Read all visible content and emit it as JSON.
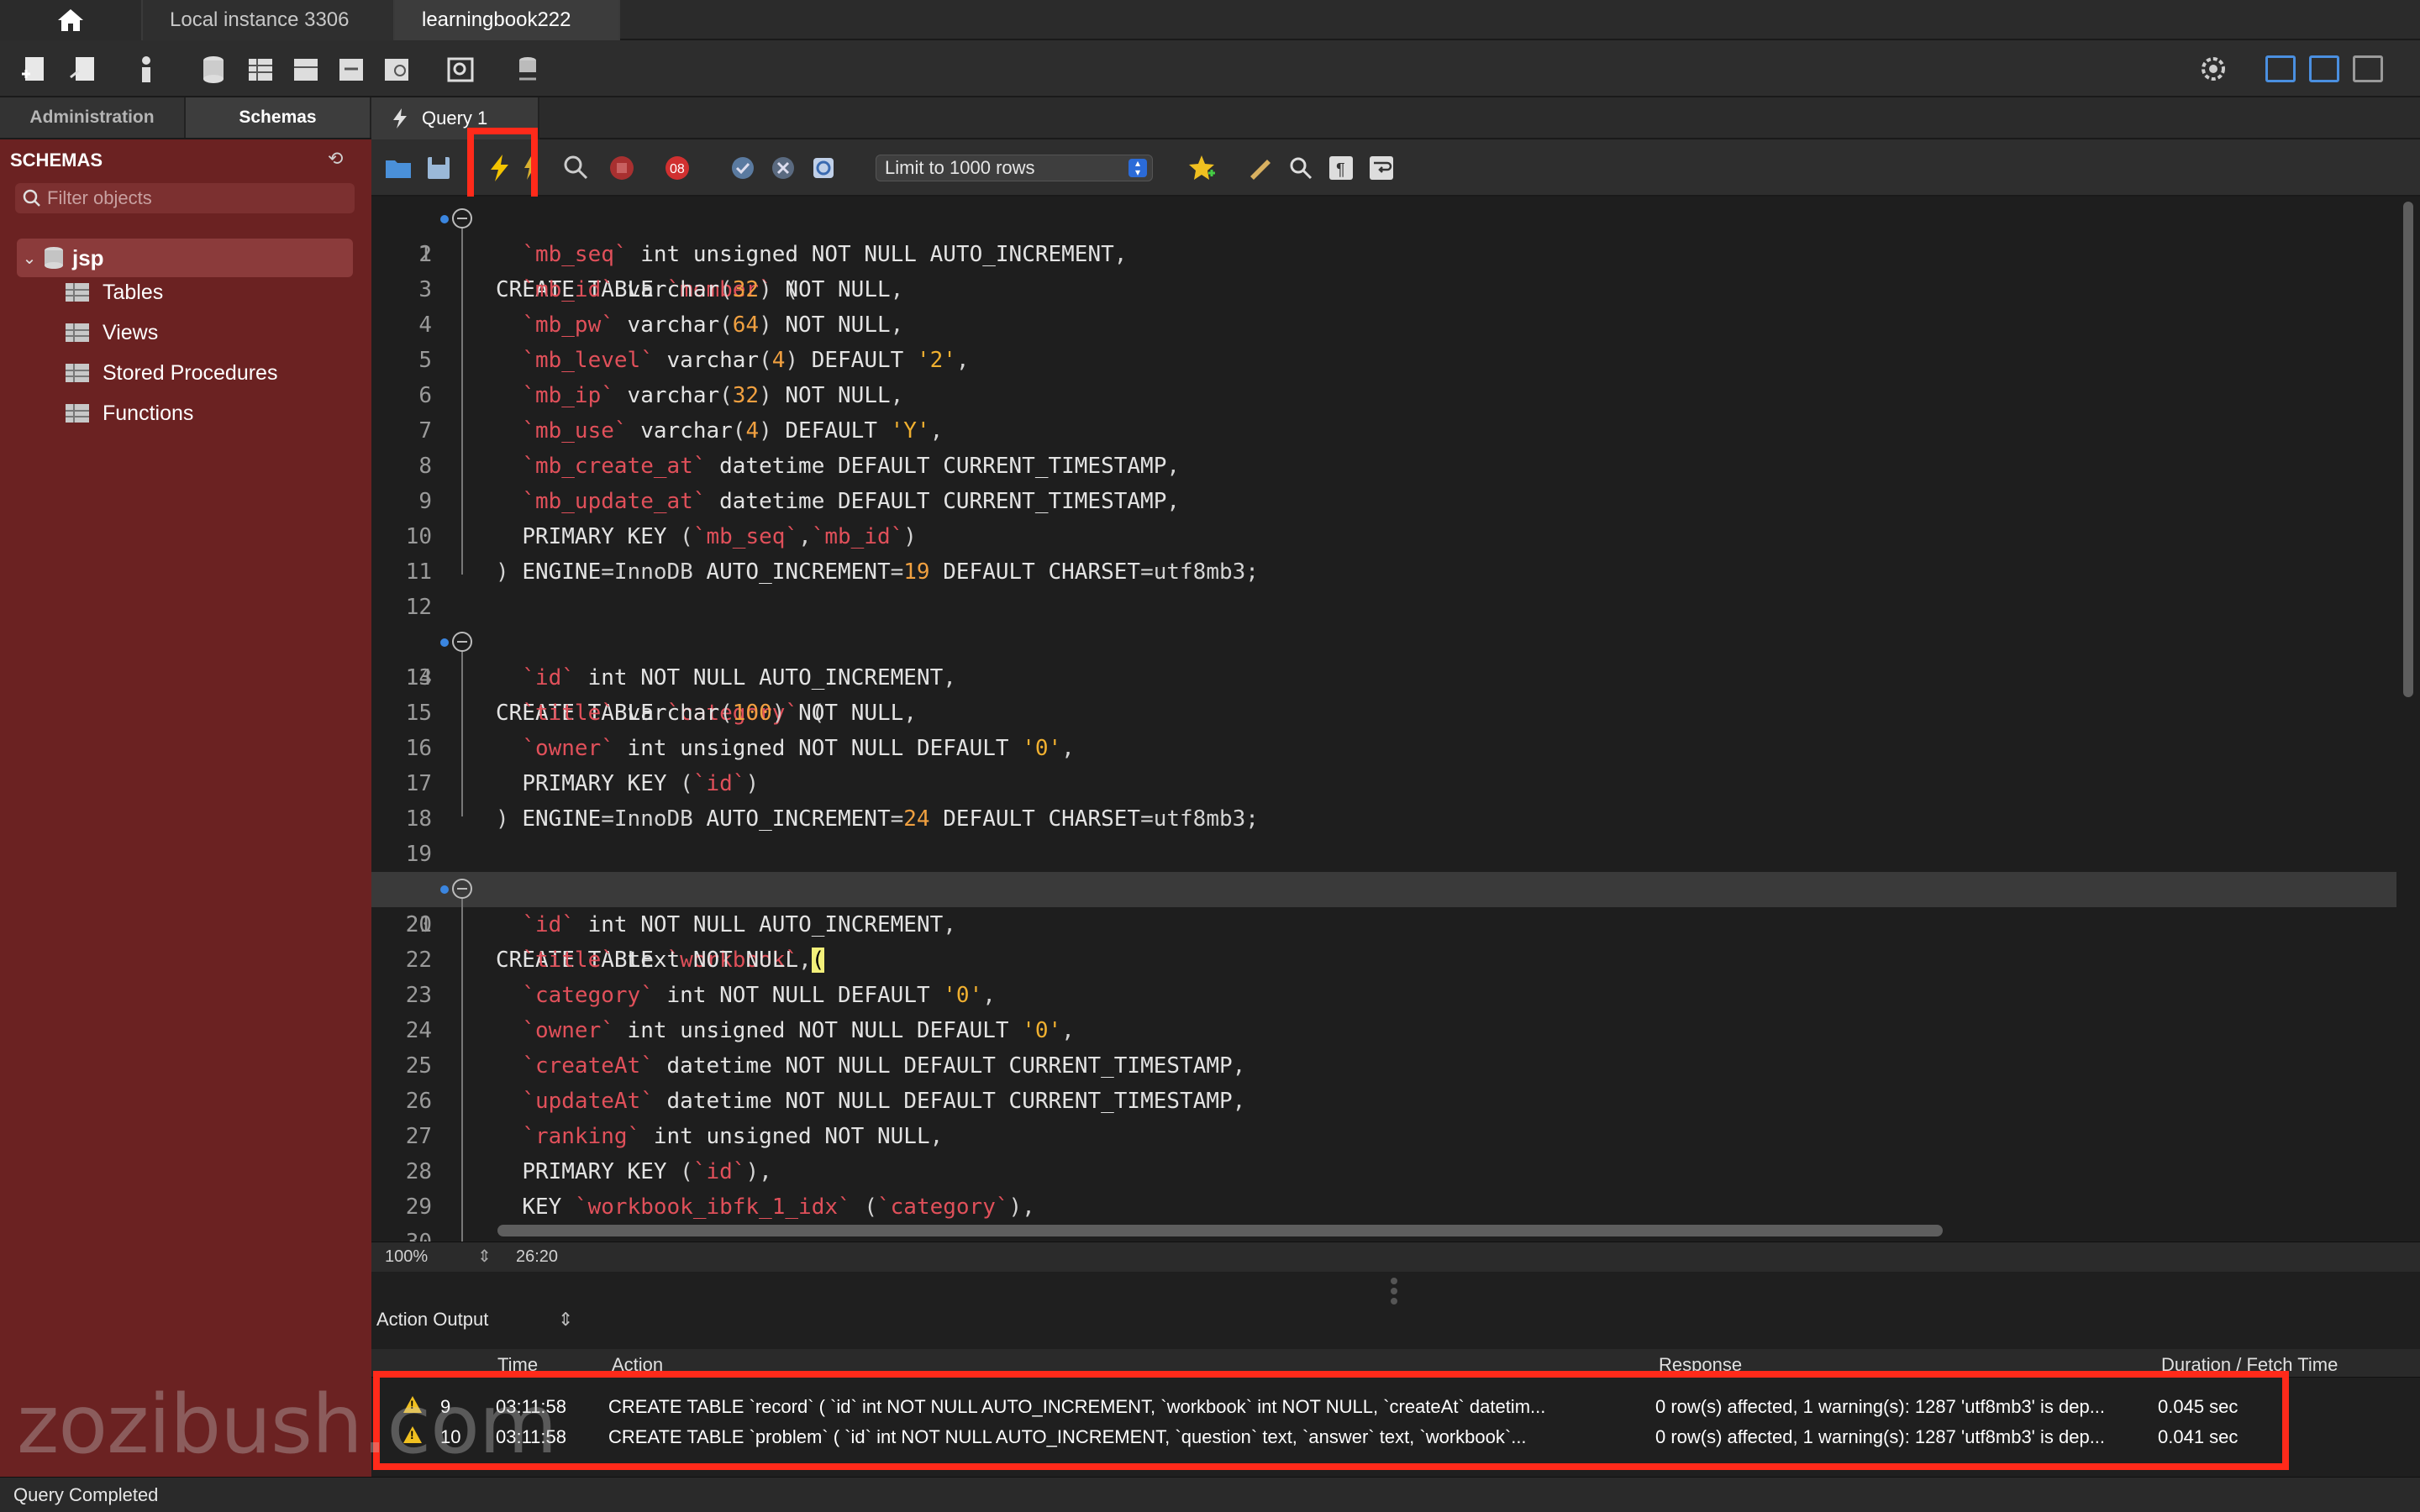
{
  "tabs": {
    "home": "home",
    "connections": [
      {
        "label": "Local instance 3306",
        "active": false
      },
      {
        "label": "learningbook222",
        "active": true
      }
    ]
  },
  "sidebar": {
    "tabs": [
      {
        "label": "Administration",
        "active": false
      },
      {
        "label": "Schemas",
        "active": true
      }
    ],
    "heading": "SCHEMAS",
    "filter_placeholder": "Filter objects",
    "schema": "jsp",
    "items": [
      "Tables",
      "Views",
      "Stored Procedures",
      "Functions"
    ]
  },
  "query_tab": {
    "label": "Query 1"
  },
  "sql_toolbar": {
    "limit_select": "Limit to 1000 rows"
  },
  "editor": {
    "lines": [
      "CREATE TABLE `member` (",
      "  `mb_seq` int unsigned NOT NULL AUTO_INCREMENT,",
      "  `mb_id` varchar(32) NOT NULL,",
      "  `mb_pw` varchar(64) NOT NULL,",
      "  `mb_level` varchar(4) DEFAULT '2',",
      "  `mb_ip` varchar(32) NOT NULL,",
      "  `mb_use` varchar(4) DEFAULT 'Y',",
      "  `mb_create_at` datetime DEFAULT CURRENT_TIMESTAMP,",
      "  `mb_update_at` datetime DEFAULT CURRENT_TIMESTAMP,",
      "  PRIMARY KEY (`mb_seq`,`mb_id`)",
      ") ENGINE=InnoDB AUTO_INCREMENT=19 DEFAULT CHARSET=utf8mb3;",
      "",
      "CREATE TABLE `category` (",
      "  `id` int NOT NULL AUTO_INCREMENT,",
      "  `title` varchar(100) NOT NULL,",
      "  `owner` int unsigned NOT NULL DEFAULT '0',",
      "  PRIMARY KEY (`id`)",
      ") ENGINE=InnoDB AUTO_INCREMENT=24 DEFAULT CHARSET=utf8mb3;",
      "",
      "CREATE TABLE `workbook` (",
      "  `id` int NOT NULL AUTO_INCREMENT,",
      "  `title` text NOT NULL,",
      "  `category` int NOT NULL DEFAULT '0',",
      "  `owner` int unsigned NOT NULL DEFAULT '0',",
      "  `createAt` datetime NOT NULL DEFAULT CURRENT_TIMESTAMP,",
      "  `updateAt` datetime NOT NULL DEFAULT CURRENT_TIMESTAMP,",
      "  `ranking` int unsigned NOT NULL,",
      "  PRIMARY KEY (`id`),",
      "  KEY `workbook_ibfk_1_idx` (`category`),",
      ""
    ],
    "highlight_line": 20,
    "zoom": "100%",
    "cursor_pos": "26:20"
  },
  "output": {
    "selector": "Action Output",
    "columns": [
      "",
      "Time",
      "Action",
      "Response",
      "Duration / Fetch Time"
    ],
    "rows": [
      {
        "num": "9",
        "time": "03:11:58",
        "action": "CREATE TABLE `record` (   `id` int NOT NULL AUTO_INCREMENT,   `workbook` int NOT NULL,   `createAt` datetim...",
        "response": "0 row(s) affected, 1 warning(s): 1287 'utf8mb3' is dep...",
        "duration": "0.045 sec"
      },
      {
        "num": "10",
        "time": "03:11:58",
        "action": "CREATE TABLE `problem` (   `id` int NOT NULL AUTO_INCREMENT,   `question` text,   `answer` text,   `workbook`...",
        "response": "0 row(s) affected, 1 warning(s): 1287 'utf8mb3' is dep...",
        "duration": "0.041 sec"
      }
    ]
  },
  "status": "Query Completed",
  "watermark": "zozibush.com",
  "colors": {
    "sidebar": "#6b2222",
    "highlight_box": "#ff2a1a",
    "identifier": "#e0505a",
    "number": "#f0a040"
  }
}
